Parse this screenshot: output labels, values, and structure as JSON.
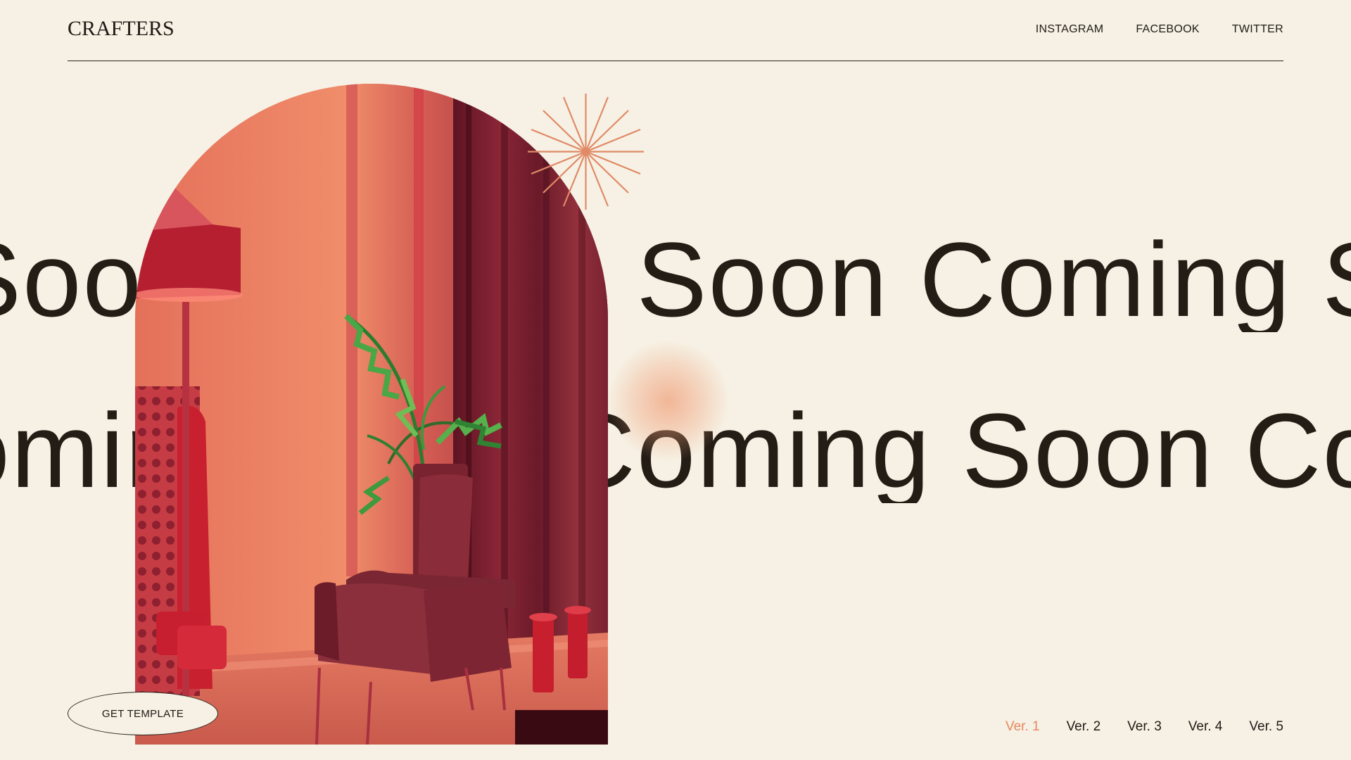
{
  "header": {
    "logo": "CRAFTERS",
    "nav": [
      {
        "label": "INSTAGRAM"
      },
      {
        "label": "FACEBOOK"
      },
      {
        "label": "TWITTER"
      }
    ]
  },
  "hero": {
    "marquee_row_1": "Soon Coming Soon Coming Soon Coming Soon Coming",
    "marquee_row_2": "Coming Soon Coming Soon Coming Soon Coming Soon",
    "image_subject": "red lounge chair interior with plant, floor lamp and curtains",
    "accent_color": "#e8875f",
    "glow_color": "#f0966e"
  },
  "cta": {
    "label": "GET TEMPLATE"
  },
  "versions": {
    "active_index": 0,
    "items": [
      {
        "label": "Ver. 1"
      },
      {
        "label": "Ver. 2"
      },
      {
        "label": "Ver. 3"
      },
      {
        "label": "Ver. 4"
      },
      {
        "label": "Ver. 5"
      }
    ]
  }
}
